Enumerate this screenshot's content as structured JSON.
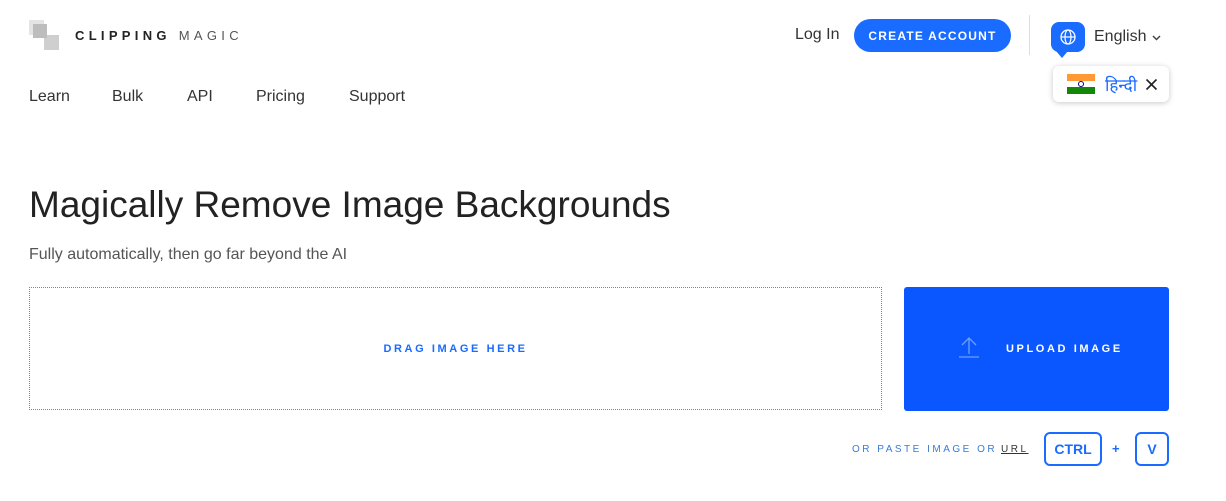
{
  "brand": {
    "name_bold": "CLIPPING",
    "name_light": "MAGIC"
  },
  "header": {
    "login_label": "Log In",
    "create_account_label": "CREATE ACCOUNT",
    "language": {
      "current": "English",
      "suggestion": "हिन्दी"
    }
  },
  "nav": {
    "items": [
      "Learn",
      "Bulk",
      "API",
      "Pricing",
      "Support"
    ]
  },
  "hero": {
    "title": "Magically Remove Image Backgrounds",
    "subtitle": "Fully automatically, then go far beyond the AI"
  },
  "upload": {
    "drop_label": "DRAG IMAGE HERE",
    "upload_label": "UPLOAD IMAGE",
    "paste_prefix": "OR PASTE IMAGE OR",
    "url_label": "URL",
    "key_ctrl": "CTRL",
    "plus": "+",
    "key_v": "V"
  },
  "colors": {
    "accent": "#1a6bff",
    "upload_bg": "#0a57ff"
  },
  "icons": [
    "logo-mark",
    "globe-icon",
    "chevron-down-icon",
    "india-flag-icon",
    "close-icon",
    "upload-arrow-icon"
  ]
}
